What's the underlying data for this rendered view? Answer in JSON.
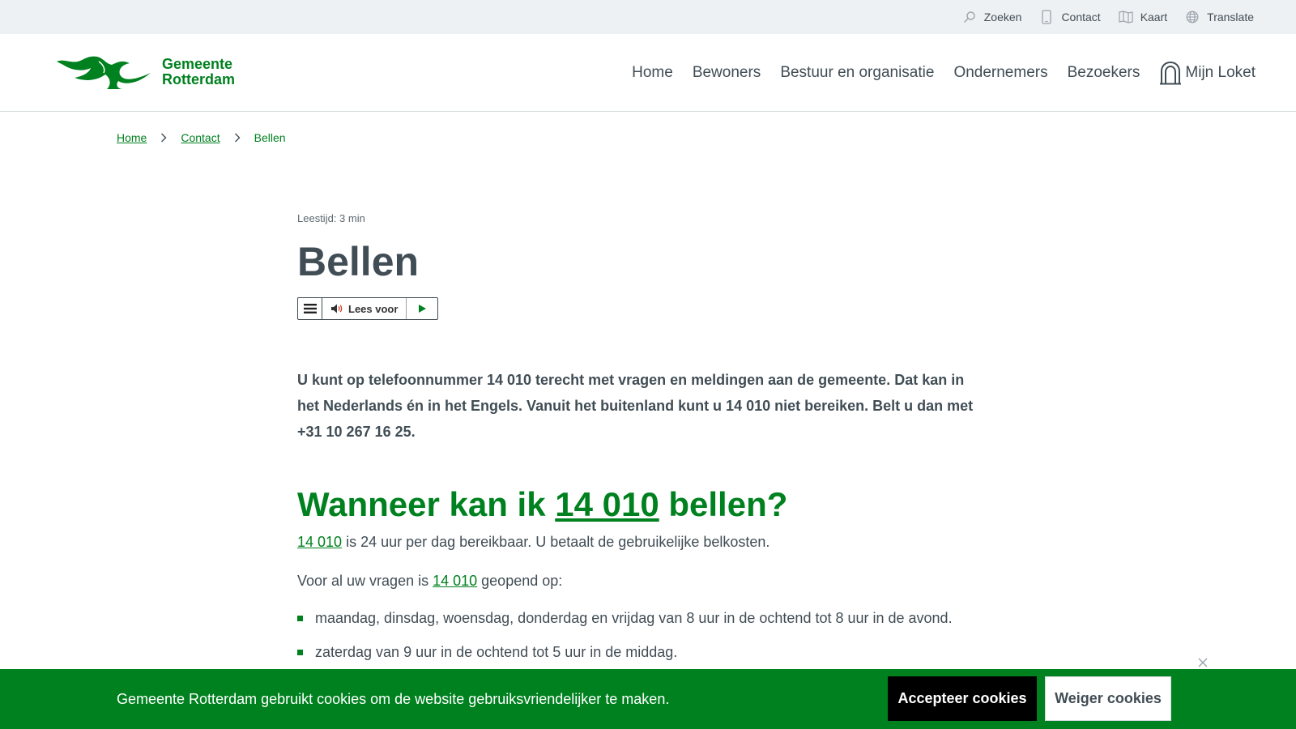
{
  "utility": {
    "items": [
      {
        "label": "Zoeken",
        "icon": "search-icon"
      },
      {
        "label": "Contact",
        "icon": "phone-icon"
      },
      {
        "label": "Kaart",
        "icon": "map-icon"
      },
      {
        "label": "Translate",
        "icon": "globe-icon"
      }
    ]
  },
  "header": {
    "logo_line1": "Gemeente",
    "logo_line2": "Rotterdam",
    "nav": [
      "Home",
      "Bewoners",
      "Bestuur en organisatie",
      "Ondernemers",
      "Bezoekers"
    ],
    "loket_label": "Mijn Loket"
  },
  "breadcrumb": {
    "items": [
      "Home",
      "Contact",
      "Bellen"
    ]
  },
  "page": {
    "reading_time": "Leestijd: 3 min",
    "title": "Bellen",
    "readspeaker_label": "Lees voor",
    "intro": "U kunt op telefoonnummer 14 010 terecht met vragen en meldingen aan de gemeente. Dat kan in het Nederlands én in het Engels. Vanuit het buitenland kunt u 14 010 niet bereiken. Belt u dan met +31 10 267 16 25.",
    "section_title_before": "Wanneer kan ik ",
    "section_title_number": "14 010",
    "section_title_after": " bellen?",
    "para1_link": "14 010",
    "para1_rest": " is 24 uur per dag bereikbaar. U betaalt de gebruikelijke belkosten.",
    "para2_before": "Voor al uw vragen is ",
    "para2_link": "14 010",
    "para2_after": " geopend op:",
    "hours": [
      "maandag, dinsdag, woensdag, donderdag en vrijdag van 8 uur in de ochtend tot 8 uur in de avond.",
      "zaterdag van 9 uur in de ochtend tot 5 uur in de middag."
    ]
  },
  "cookie": {
    "text": "Gemeente Rotterdam gebruikt cookies om de website gebruiksvriendelijker te maken.",
    "accept_label": "Accepteer cookies",
    "refuse_label": "Weiger cookies"
  },
  "colors": {
    "brand_green": "#00811f",
    "text": "#414d55",
    "utility_bg": "#eef1f4"
  }
}
